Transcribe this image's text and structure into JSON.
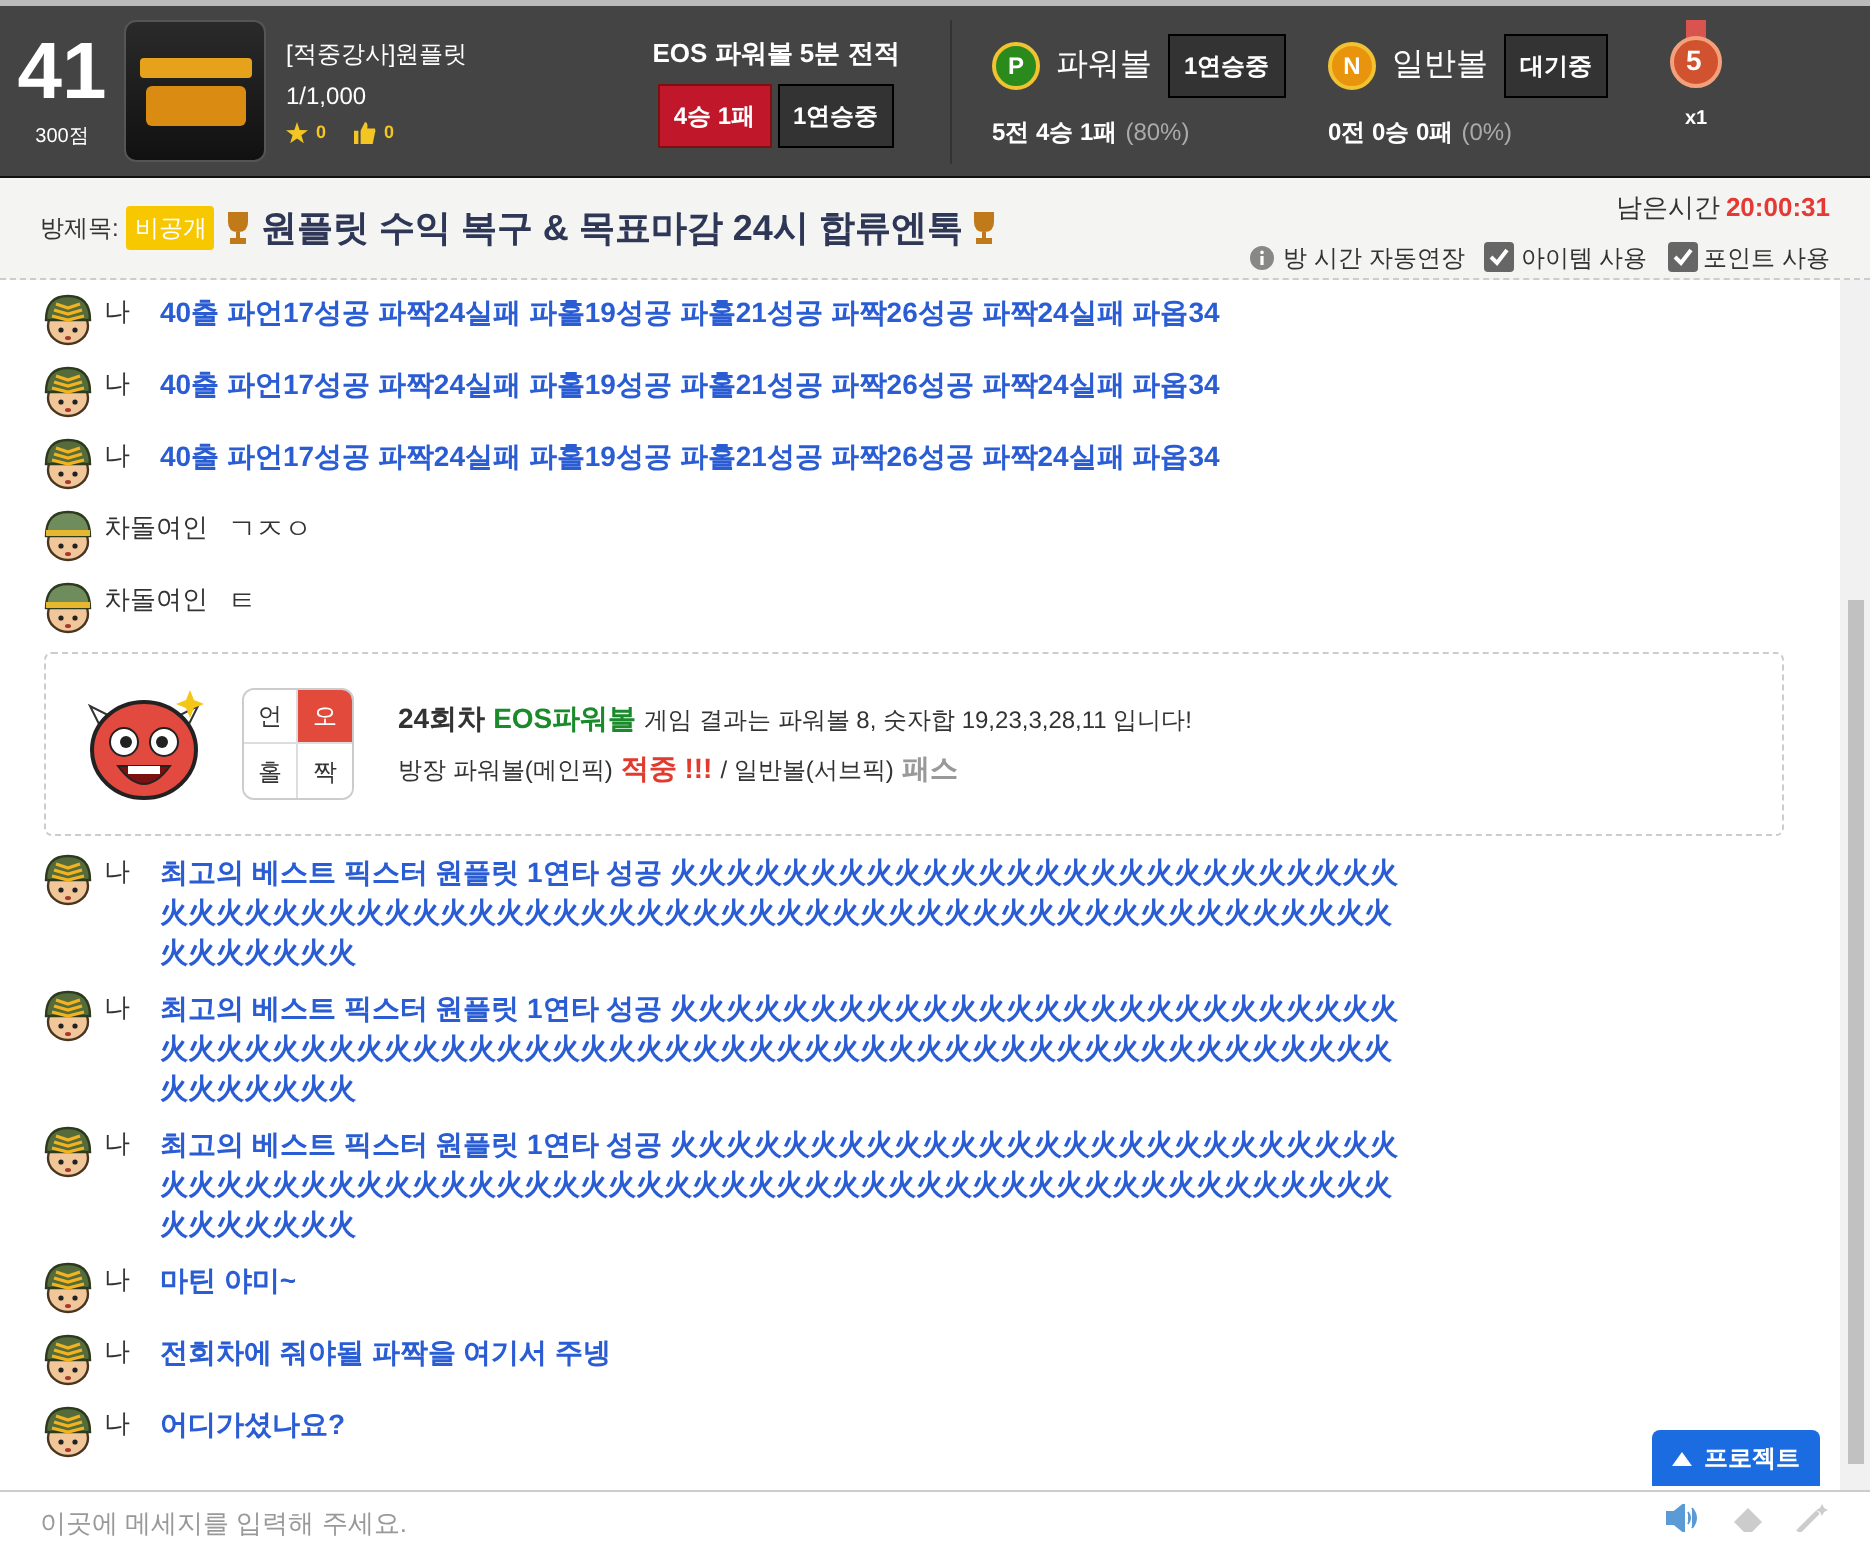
{
  "header": {
    "rank": "41",
    "points": "300점",
    "streamer": {
      "name": "[적중강사]원플릿",
      "viewers": "1/1,000",
      "stars": "0",
      "likes": "0"
    },
    "record": {
      "title": "EOS 파워볼 5분 전적",
      "result": "4승 1패",
      "streak": "1연승중"
    },
    "balls": [
      {
        "kind": "power",
        "icon_letter": "P",
        "label": "파워볼",
        "status": "1연승중",
        "stats": "5전 4승 1패",
        "rate": "(80%)"
      },
      {
        "kind": "normal",
        "icon_letter": "N",
        "label": "일반볼",
        "status": "대기중",
        "stats": "0전 0승 0패",
        "rate": "(0%)"
      }
    ],
    "medal": {
      "number": "5",
      "count": "x1"
    }
  },
  "room": {
    "label": "방제목:",
    "badge": "비공개",
    "title": "원플릿 수익 복구 & 목표마감 24시 합류엔톡",
    "time_label": "남은시간",
    "time": "20:00:31",
    "options": [
      {
        "kind": "info",
        "label": "방 시간 자동연장"
      },
      {
        "kind": "checkbox",
        "label": "아이템 사용",
        "checked": true
      },
      {
        "kind": "checkbox",
        "label": "포인트 사용",
        "checked": true
      }
    ]
  },
  "chat": [
    {
      "kind": "chat",
      "striped": true,
      "nick": "나",
      "text": "40출 파언17성공 파짝24실패 파홀19성공 파홀21성공 파짝26성공 파짝24실패 파옵34",
      "bold": true
    },
    {
      "kind": "chat",
      "striped": true,
      "nick": "나",
      "text": "40출 파언17성공 파짝24실패 파홀19성공 파홀21성공 파짝26성공 파짝24실패 파옵34",
      "bold": true
    },
    {
      "kind": "chat",
      "striped": true,
      "nick": "나",
      "text": "40출 파언17성공 파짝24실패 파홀19성공 파홀21성공 파짝26성공 파짝24실패 파옵34",
      "bold": true
    },
    {
      "kind": "chat",
      "striped": false,
      "nick": "차돌여인",
      "text": "ㄱㅈㅇ",
      "bold": false
    },
    {
      "kind": "chat",
      "striped": false,
      "nick": "차돌여인",
      "text": "ㅌ",
      "bold": false
    },
    {
      "kind": "result",
      "cells": [
        {
          "label": "언",
          "selected": false
        },
        {
          "label": "오",
          "selected": true
        },
        {
          "label": "홀",
          "selected": false
        },
        {
          "label": "짝",
          "selected": false
        }
      ],
      "round": "24회차",
      "game": "EOS파워볼",
      "summary": "게임 결과는 파워볼 8, 숫자합 19,23,3,28,11 입니다!",
      "main_pick": "방장 파워볼(메인픽)",
      "main_result": "적중 !!!",
      "sub_pick": "/ 일반볼(서브픽)",
      "sub_result": "패스"
    },
    {
      "kind": "chat",
      "striped": true,
      "nick": "나",
      "text": "최고의 베스트 픽스터 원플릿 1연타 성공 火火火火火火火火火火火火火火火火火火火火火火火火火火火火火火火火火火火火火火火火火火火火火火火火火火火火火火火火火火火火火火火火火火火火火火火火火火火火火",
      "bold": true
    },
    {
      "kind": "chat",
      "striped": true,
      "nick": "나",
      "text": "최고의 베스트 픽스터 원플릿 1연타 성공 火火火火火火火火火火火火火火火火火火火火火火火火火火火火火火火火火火火火火火火火火火火火火火火火火火火火火火火火火火火火火火火火火火火火火火火火火火火火火",
      "bold": true
    },
    {
      "kind": "chat",
      "striped": true,
      "nick": "나",
      "text": "최고의 베스트 픽스터 원플릿 1연타 성공 火火火火火火火火火火火火火火火火火火火火火火火火火火火火火火火火火火火火火火火火火火火火火火火火火火火火火火火火火火火火火火火火火火火火火火火火火火火火火",
      "bold": true
    },
    {
      "kind": "chat",
      "striped": true,
      "nick": "나",
      "text": "마틴 야미~",
      "bold": true
    },
    {
      "kind": "chat",
      "striped": true,
      "nick": "나",
      "text": "전회차에 줘야될 파짝을 여기서 주넹",
      "bold": true
    },
    {
      "kind": "chat",
      "striped": true,
      "nick": "나",
      "text": "어디가셨나요?",
      "bold": true
    }
  ],
  "protect_button": "프로젝트",
  "input": {
    "placeholder": "이곳에 메세지를 입력해 주세요."
  }
}
